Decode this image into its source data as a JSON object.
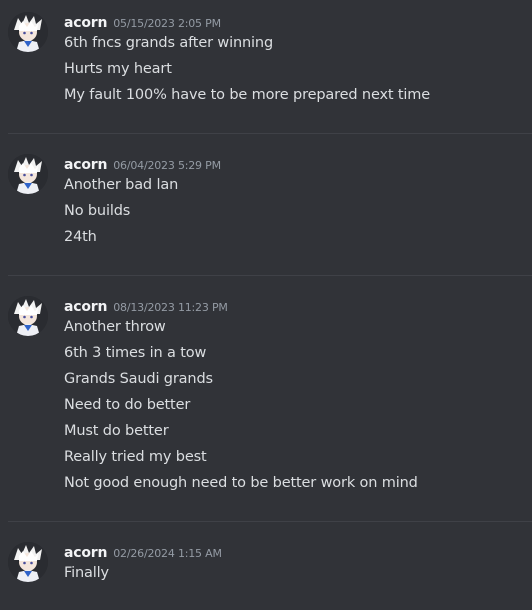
{
  "messages": [
    {
      "username": "acorn",
      "timestamp": "05/15/2023 2:05 PM",
      "lines": [
        "6th fncs grands after winning",
        "Hurts my heart",
        "My fault 100% have to be more prepared next time"
      ]
    },
    {
      "username": "acorn",
      "timestamp": "06/04/2023 5:29 PM",
      "lines": [
        "Another bad lan",
        "No builds",
        "24th"
      ]
    },
    {
      "username": "acorn",
      "timestamp": "08/13/2023 11:23 PM",
      "lines": [
        "Another throw",
        "6th 3 times in a tow",
        "Grands Saudi grands",
        "Need to do better",
        "Must do better",
        "Really tried my best",
        "Not good enough need to be better work on mind"
      ]
    },
    {
      "username": "acorn",
      "timestamp": "02/26/2024 1:15 AM",
      "lines": [
        "Finally"
      ]
    }
  ]
}
